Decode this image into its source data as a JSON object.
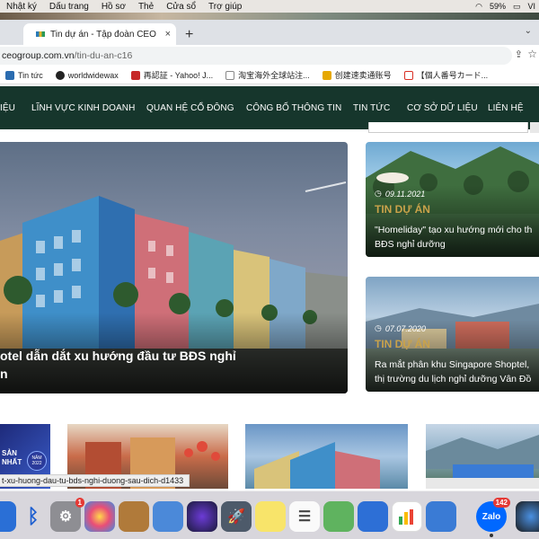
{
  "menubar": {
    "items": [
      "Nhật ký",
      "Dấu trang",
      "Hồ sơ",
      "Thẻ",
      "Cửa sổ",
      "Trợ giúp"
    ],
    "battery": "59%",
    "input_method": "VI"
  },
  "tab": {
    "title": "Tin dự án - Tập đoàn CEO",
    "close": "×",
    "new_tab": "+"
  },
  "address": {
    "host": "ceogroup.com.vn",
    "path": "/tin-du-an-c16"
  },
  "bookmarks": [
    {
      "label": "Tin tức",
      "color": "#2b6cb0"
    },
    {
      "label": "worldwidewax",
      "color": "#222222"
    },
    {
      "label": "再認証 - Yahoo! J...",
      "color": "#c62828"
    },
    {
      "label": "淘宝海外全球站注...",
      "color": "#555555"
    },
    {
      "label": "创建速卖通账号",
      "color": "#e6a800"
    },
    {
      "label": "【個人番号カード...",
      "color": "#d93025"
    }
  ],
  "nav": {
    "items": [
      "IỆU",
      "LĨNH VỰC KINH DOANH",
      "QUAN HỆ CỔ ĐÔNG",
      "CÔNG BỐ THÔNG TIN",
      "TIN TỨC",
      "CƠ SỞ DỮ LIỆU",
      "LIÊN HỆ"
    ]
  },
  "hero": {
    "title_line1": "otel dẫn dắt xu hướng đầu tư BĐS nghỉ",
    "title_line2": "n"
  },
  "cards": [
    {
      "date": "09.11.2021",
      "category": "TIN DỰ ÁN",
      "title_line1": "\"Homeliday\" tạo xu hướng mới cho th",
      "title_line2": "BĐS nghỉ dưỡng"
    },
    {
      "date": "07.07.2020",
      "category": "TIN DỰ ÁN",
      "title_line1": "Ra mắt phân khu Singapore Shoptel,",
      "title_line2": "thị trường du lịch nghỉ dưỡng Vân Đồ"
    }
  ],
  "thumbs": {
    "t1_line1": "SẢN",
    "t1_line2": "NHẤT",
    "t1_badge": "NĂM 2022"
  },
  "status_link": "t-xu-huong-dau-tu-bds-nghi-duong-sau-dich-d1433",
  "dock": {
    "settings_badge": "1",
    "zalo_label": "Zalo",
    "zalo_badge": "142"
  },
  "colors": {
    "nav_bg": "#16362c",
    "category": "#c9a24a"
  }
}
